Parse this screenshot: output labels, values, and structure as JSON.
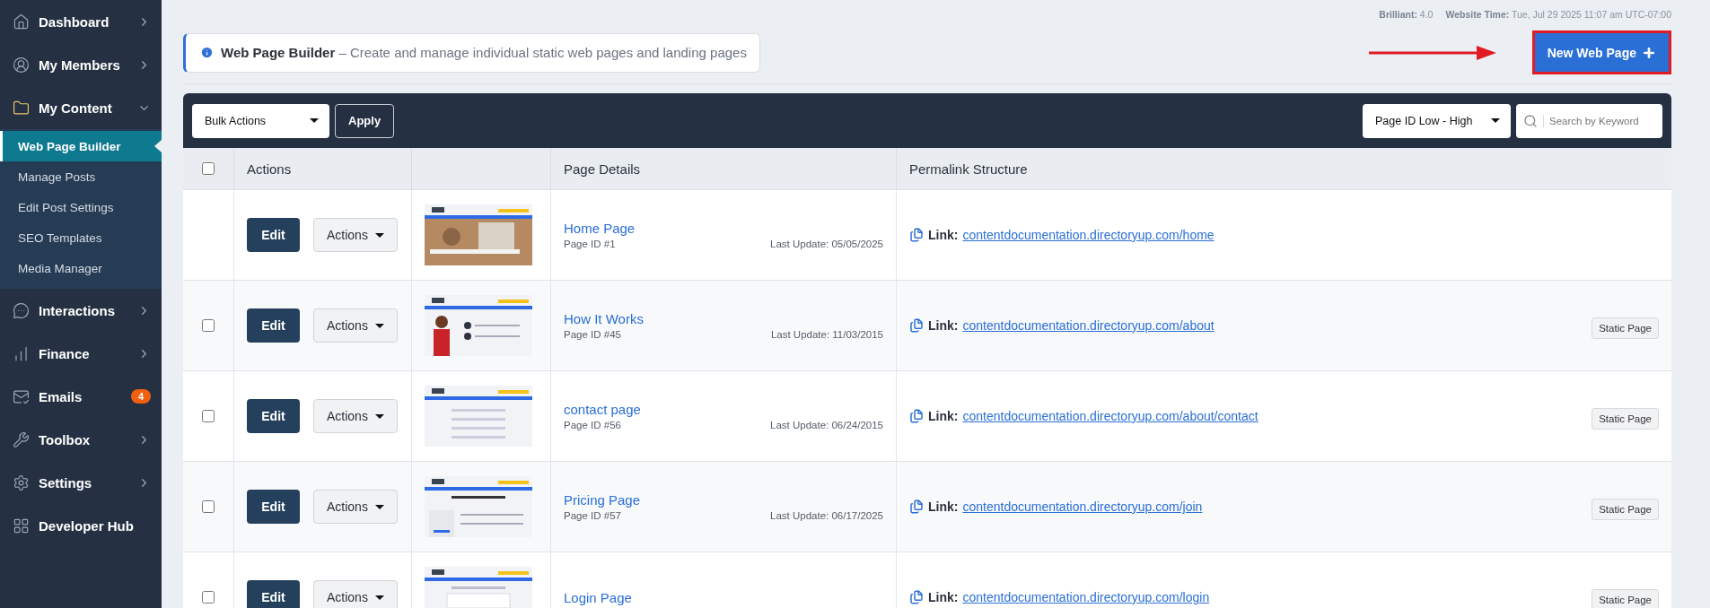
{
  "sidebar": {
    "items": [
      {
        "label": "Dashboard",
        "expanded": false
      },
      {
        "label": "My Members",
        "expanded": false
      },
      {
        "label": "My Content",
        "expanded": true,
        "children": [
          {
            "label": "Web Page Builder",
            "selected": true
          },
          {
            "label": "Manage Posts",
            "selected": false
          },
          {
            "label": "Edit Post Settings",
            "selected": false
          },
          {
            "label": "SEO Templates",
            "selected": false
          },
          {
            "label": "Media Manager",
            "selected": false
          }
        ]
      },
      {
        "label": "Interactions",
        "expanded": false
      },
      {
        "label": "Finance",
        "expanded": false
      },
      {
        "label": "Emails",
        "badge": "4"
      },
      {
        "label": "Toolbox",
        "expanded": false
      },
      {
        "label": "Settings",
        "expanded": false
      },
      {
        "label": "Developer Hub"
      }
    ]
  },
  "meta": [
    "**Brilliant:** 4.0",
    "**Website Time:** Tue, Jul 29 2025 11:07 am UTC-07:00"
  ],
  "notice": "**Web Page Builder** – Create and manage individual static web pages and landing pages",
  "new_button": "New Web Page",
  "toolbar": {
    "bulk_actions": "Bulk Actions",
    "apply": "Apply",
    "sort": "Page ID Low - High",
    "search": {
      "placeholder": "Search by Keyword"
    }
  },
  "table": {
    "header_checked": false,
    "columns": [
      "Actions",
      "Page Details",
      "Permalink Structure"
    ],
    "rows": [
      {
        "edit": "Edit",
        "actions": "Actions",
        "title": "Home Page",
        "page_id": "Page ID #1",
        "updated": "Last Update: 05/05/2025",
        "link_label": "Link:",
        "link": "contentdocumentation.directoryup.com/home"
      },
      {
        "checked": false,
        "edit": "Edit",
        "actions": "Actions",
        "title": "How It Works",
        "page_id": "Page ID #45",
        "updated": "Last Update: 11/03/2015",
        "link_label": "Link:",
        "link": "contentdocumentation.directoryup.com/about",
        "tag": "Static Page"
      },
      {
        "checked": false,
        "edit": "Edit",
        "actions": "Actions",
        "title": "contact page",
        "page_id": "Page ID #56",
        "updated": "Last Update: 06/24/2015",
        "link_label": "Link:",
        "link": "contentdocumentation.directoryup.com/about/contact",
        "tag": "Static Page"
      },
      {
        "checked": false,
        "edit": "Edit",
        "actions": "Actions",
        "title": "Pricing Page",
        "page_id": "Page ID #57",
        "updated": "Last Update: 06/17/2025",
        "link_label": "Link:",
        "link": "contentdocumentation.directoryup.com/join",
        "tag": "Static Page"
      },
      {
        "checked": false,
        "edit": "Edit",
        "actions": "Actions",
        "title": "Login Page",
        "link_label": "Link:",
        "link": "contentdocumentation.directoryup.com/login",
        "tag": "Static Page"
      }
    ]
  }
}
